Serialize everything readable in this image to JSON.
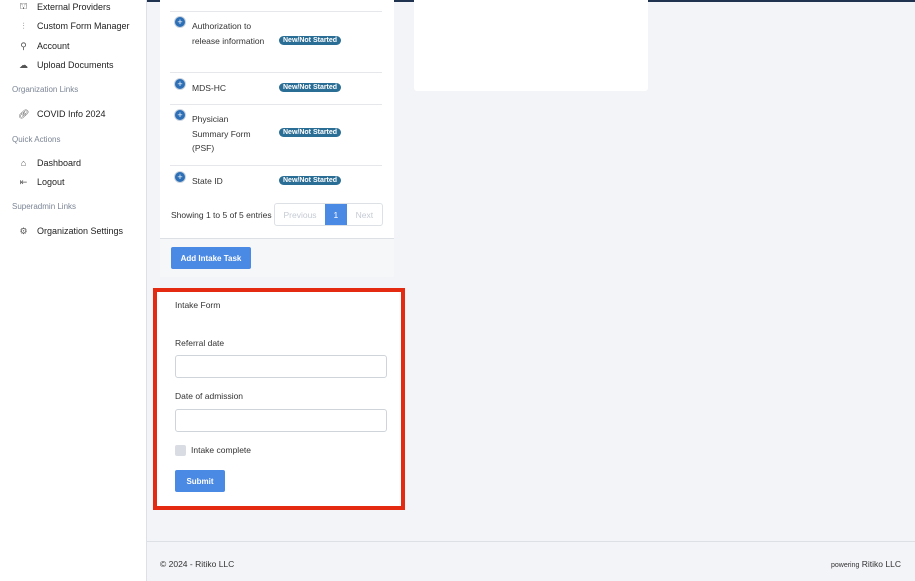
{
  "sidebar": {
    "items": [
      {
        "label": "External Providers",
        "icon": "providers-icon"
      },
      {
        "label": "Custom Form Manager",
        "icon": "sliders-icon"
      },
      {
        "label": "Account",
        "icon": "user-icon"
      },
      {
        "label": "Upload Documents",
        "icon": "cloud-upload-icon"
      }
    ],
    "org_links_heading": "Organization Links",
    "org_links": [
      {
        "label": "COVID Info 2024",
        "icon": "link-icon"
      }
    ],
    "quick_actions_heading": "Quick Actions",
    "quick_actions": [
      {
        "label": "Dashboard",
        "icon": "home-icon"
      },
      {
        "label": "Logout",
        "icon": "logout-icon"
      }
    ],
    "superadmin_heading": "Superadmin Links",
    "superadmin_links": [
      {
        "label": "Organization Settings",
        "icon": "gear-icon"
      }
    ]
  },
  "tasks": {
    "rows": [
      {
        "name": "Authorization to release information",
        "status": "New/Not Started"
      },
      {
        "name": "MDS-HC",
        "status": "New/Not Started"
      },
      {
        "name": "Physician Summary Form (PSF)",
        "status": "New/Not Started"
      },
      {
        "name": "State ID",
        "status": "New/Not Started"
      }
    ],
    "info": "Showing 1 to 5 of 5 entries",
    "prev": "Previous",
    "page": "1",
    "next": "Next",
    "add_button": "Add Intake Task"
  },
  "intake_form": {
    "title": "Intake Form",
    "referral_label": "Referral date",
    "referral_value": "",
    "admission_label": "Date of admission",
    "admission_value": "",
    "complete_label": "Intake complete",
    "complete_checked": false,
    "submit": "Submit"
  },
  "footer": {
    "copyright": "© 2024 - Ritiko LLC",
    "powering": "powering",
    "brand": "Ritiko LLC"
  },
  "colors": {
    "accent": "#4a89e4",
    "badge": "#2a6e96",
    "highlight": "#e52a12"
  }
}
